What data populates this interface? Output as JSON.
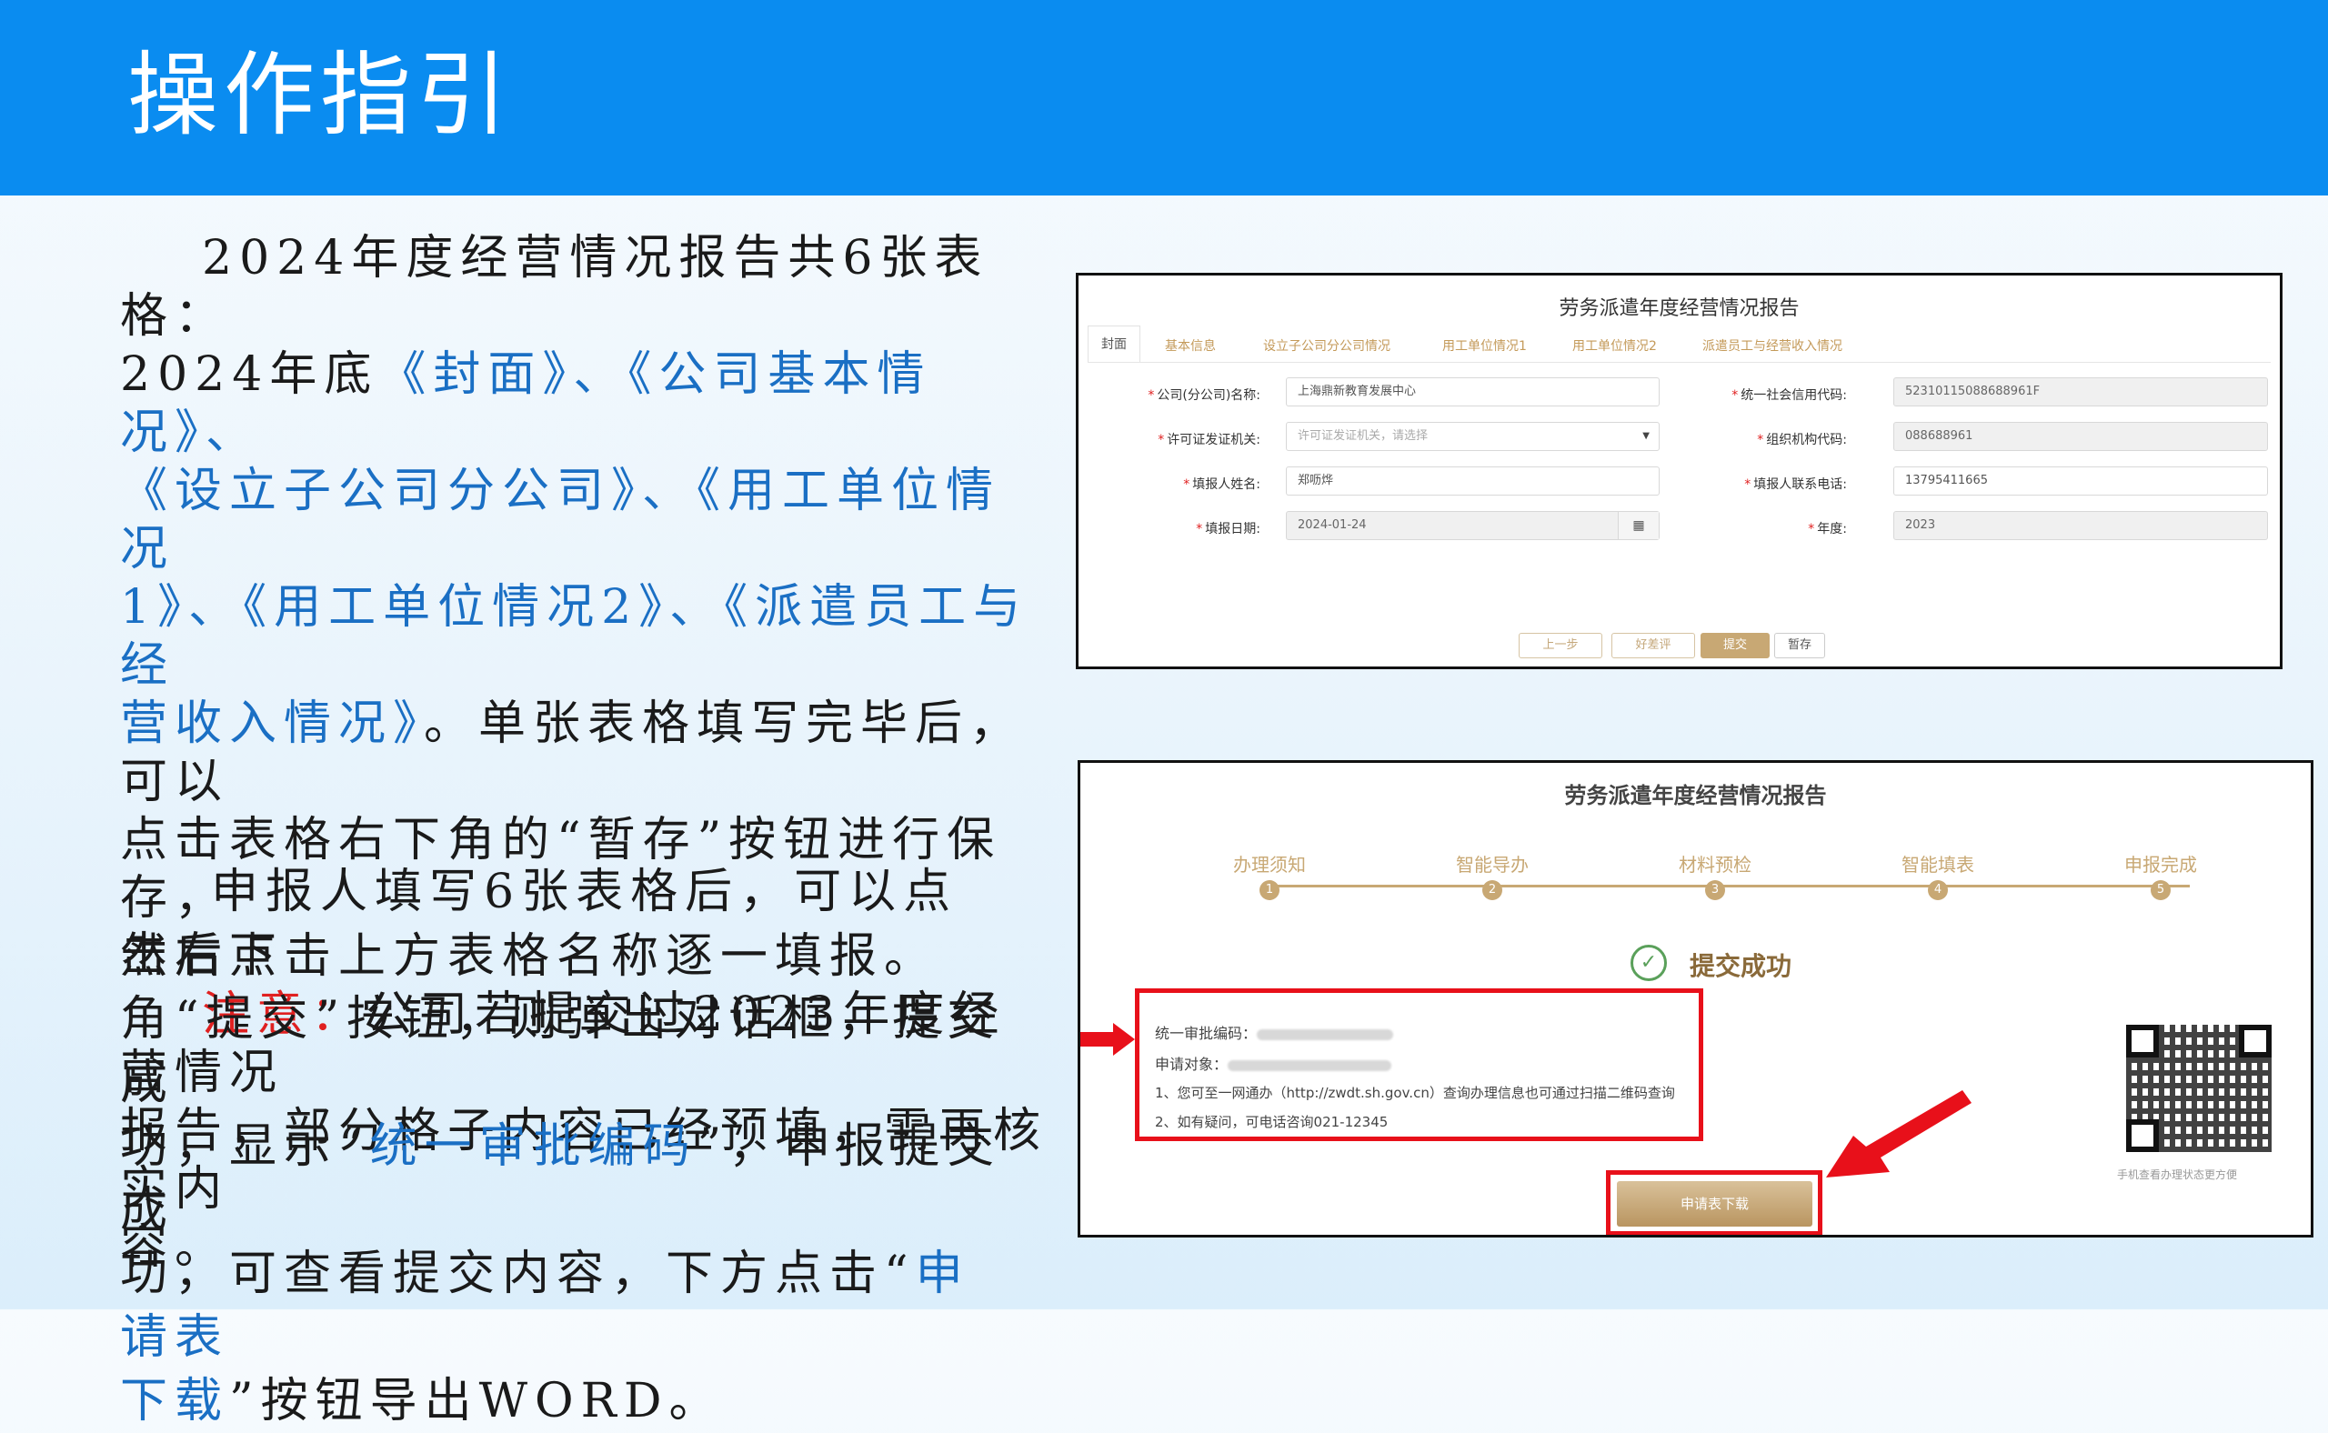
{
  "slide": {
    "title": "操作指引"
  },
  "para1": {
    "l1": "2024年度经营情况报告共6张表格：",
    "l2a": "2024年底",
    "l2b": "《封面》、《公司基本情况》、",
    "l3": "《设立子公司分公司》、《用工单位情况",
    "l4": "1》、《用工单位情况2》、《派遣员工与经",
    "l5a": "营收入情况》",
    "l5b": "。单张表格填写完毕后，可以",
    "l6": "点击表格右下角的“暂存”按钮进行保存，",
    "l7": "然后点击上方表格名称逐一填报。",
    "note_label": "注意：",
    "note_text": "公司若提交过2023年度经营情况",
    "l9": "报告，部分格子内容已经预填，需再核实内",
    "l10": "容。"
  },
  "para2": {
    "l1": "申报人填写6张表格后，可以点击右下",
    "l2": "角“提交”按钮，则弹出对话框，提交成",
    "l3a": "功，显示“",
    "l3b": "统一审批编码",
    "l3c": "”，申报提交成",
    "l4a": "功，可查看提交内容，下方点击“",
    "l4b": "申请表",
    "l5a": "下载",
    "l5b": "”按钮导出WORD。"
  },
  "shot1": {
    "title": "劳务派遣年度经营情况报告",
    "tabs": [
      "封面",
      "基本信息",
      "设立子公司分公司情况",
      "用工单位情况1",
      "用工单位情况2",
      "派遣员工与经营收入情况"
    ],
    "fields": {
      "company_label": "公司(分公司)名称:",
      "company_value": "上海鼎新教育发展中心",
      "credit_label": "统一社会信用代码:",
      "credit_value": "52310115088688961F",
      "license_label": "许可证发证机关:",
      "license_placeholder": "许可证发证机关，请选择",
      "org_label": "组织机构代码:",
      "org_value": "088688961",
      "filler_label": "填报人姓名:",
      "filler_value": "郑呖烨",
      "phone_label": "填报人联系电话:",
      "phone_value": "13795411665",
      "date_label": "填报日期:",
      "date_value": "2024-01-24",
      "year_label": "年度:",
      "year_value": "2023"
    },
    "buttons": {
      "prev": "上一步",
      "review": "好差评",
      "submit": "提交",
      "save": "暂存"
    }
  },
  "shot2": {
    "title": "劳务派遣年度经营情况报告",
    "steps": [
      {
        "label": "办理须知",
        "num": "1"
      },
      {
        "label": "智能导办",
        "num": "2"
      },
      {
        "label": "材料预检",
        "num": "3"
      },
      {
        "label": "智能填表",
        "num": "4"
      },
      {
        "label": "申报完成",
        "num": "5"
      }
    ],
    "success": "提交成功",
    "code_label": "统一审批编码：",
    "target_label": "申请对象：",
    "note1": "1、您可至一网通办（http://zwdt.sh.gov.cn）查询办理信息也可通过扫描二维码查询",
    "note2": "2、如有疑问，可电话咨询021-12345",
    "qr_caption": "手机查看办理状态更方便",
    "download": "申请表下载"
  },
  "colors": {
    "header": "#0a8cf0",
    "link": "#1a6fc4",
    "note": "#e02020",
    "gold": "#c8a874",
    "highlight": "#e8101a"
  }
}
